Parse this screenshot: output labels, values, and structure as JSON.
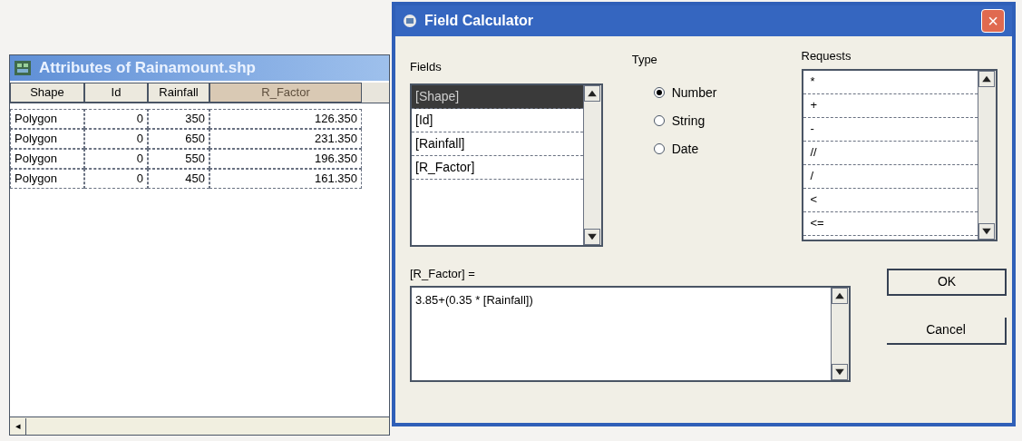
{
  "table_window": {
    "title": "Attributes of Rainamount.shp",
    "columns": [
      {
        "label": "Shape",
        "selected": false
      },
      {
        "label": "Id",
        "selected": false
      },
      {
        "label": "Rainfall",
        "selected": false
      },
      {
        "label": "R_Factor",
        "selected": true
      }
    ],
    "rows": [
      [
        "Polygon",
        "0",
        "350",
        "126.350"
      ],
      [
        "Polygon",
        "0",
        "650",
        "231.350"
      ],
      [
        "Polygon",
        "0",
        "550",
        "196.350"
      ],
      [
        "Polygon",
        "0",
        "450",
        "161.350"
      ]
    ],
    "scroll_left": "◂"
  },
  "dialog": {
    "title": "Field Calculator",
    "close": "×",
    "fields_label": "Fields",
    "fields": [
      {
        "label": "[Shape]",
        "selected": true
      },
      {
        "label": "[Id]",
        "selected": false
      },
      {
        "label": "[Rainfall]",
        "selected": false
      },
      {
        "label": "[R_Factor]",
        "selected": false
      }
    ],
    "type_label": "Type",
    "types": [
      {
        "label": "Number",
        "selected": true
      },
      {
        "label": "String",
        "selected": false
      },
      {
        "label": "Date",
        "selected": false
      }
    ],
    "requests_label": "Requests",
    "requests": [
      "*",
      "+",
      "-",
      "//",
      "/",
      "<",
      "<="
    ],
    "expression_label": "[R_Factor] =",
    "expression": "3.85+(0.35 * [Rainfall])",
    "buttons": [
      "OK",
      "Cancel"
    ]
  }
}
